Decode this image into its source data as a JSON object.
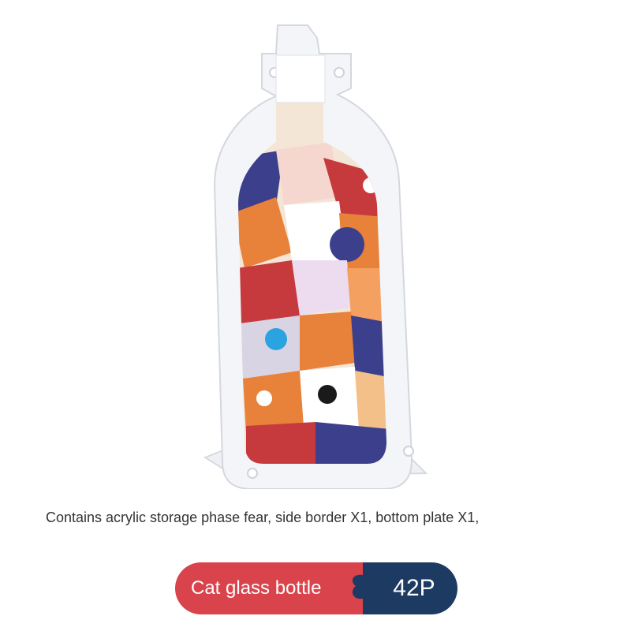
{
  "caption": {
    "text": "Contains acrylic storage phase fear, side border X1, bottom plate X1,"
  },
  "badge": {
    "label": "Cat glass bottle",
    "count": "42P",
    "left_color": "#d9434b",
    "right_color": "#1d3a63"
  },
  "colors": {
    "background": "#ffffff",
    "acrylic": "#f1f3f6",
    "cat_orange": "#e8823a",
    "cat_navy": "#3b3f8c",
    "cat_red": "#c63a3e",
    "cat_cream": "#f3e6d6"
  }
}
